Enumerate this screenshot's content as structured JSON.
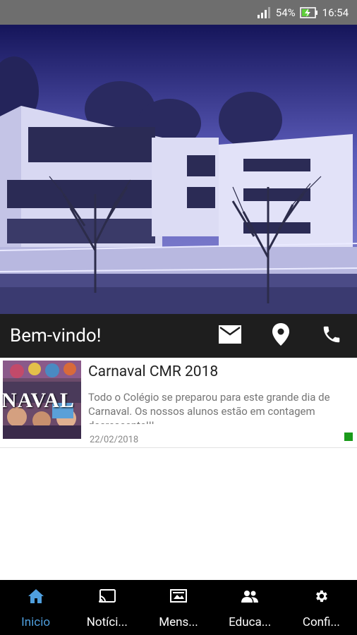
{
  "status_bar": {
    "battery": "54%",
    "time": "16:54"
  },
  "welcome": {
    "title": "Bem-vindo!",
    "actions": [
      {
        "icon": "mail-icon"
      },
      {
        "icon": "location-pin-icon"
      },
      {
        "icon": "phone-icon"
      }
    ]
  },
  "news": [
    {
      "title": "Carnaval CMR 2018",
      "excerpt": "Todo o Colégio se preparou para este grande dia de Carnaval. Os nossos alunos estão em contagem decrescente!!!",
      "date": "22/02/2018",
      "thumb_text": "NAVAL",
      "unread_color": "#1a9a1a"
    }
  ],
  "bottom_nav": [
    {
      "label": "Inicio",
      "icon": "home-icon",
      "active": true
    },
    {
      "label": "Notíci...",
      "icon": "cast-icon",
      "active": false
    },
    {
      "label": "Mens...",
      "icon": "messages-icon",
      "active": false
    },
    {
      "label": "Educa...",
      "icon": "people-icon",
      "active": false
    },
    {
      "label": "Confi...",
      "icon": "gear-icon",
      "active": false
    }
  ],
  "colors": {
    "status_bar": "#6e6e6e",
    "welcome_bar": "#1e1e1e",
    "nav_active": "#4f9fde",
    "nav_bg": "#000000"
  }
}
